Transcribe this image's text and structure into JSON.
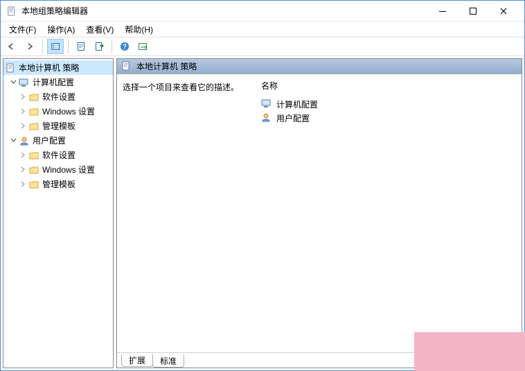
{
  "window": {
    "title": "本地组策略编辑器"
  },
  "menu": {
    "file": "文件(F)",
    "action": "操作(A)",
    "view": "查看(V)",
    "help": "帮助(H)"
  },
  "tree": {
    "root": {
      "label": "本地计算机 策略"
    },
    "computer": {
      "label": "计算机配置",
      "software": "软件设置",
      "windows": "Windows 设置",
      "admin": "管理模板"
    },
    "user": {
      "label": "用户配置",
      "software": "软件设置",
      "windows": "Windows 设置",
      "admin": "管理模板"
    }
  },
  "content": {
    "header": "本地计算机 策略",
    "description": "选择一个项目来查看它的描述。",
    "column_name": "名称",
    "items": {
      "computer": "计算机配置",
      "user": "用户配置"
    }
  },
  "tabs": {
    "extended": "扩展",
    "standard": "标准"
  }
}
